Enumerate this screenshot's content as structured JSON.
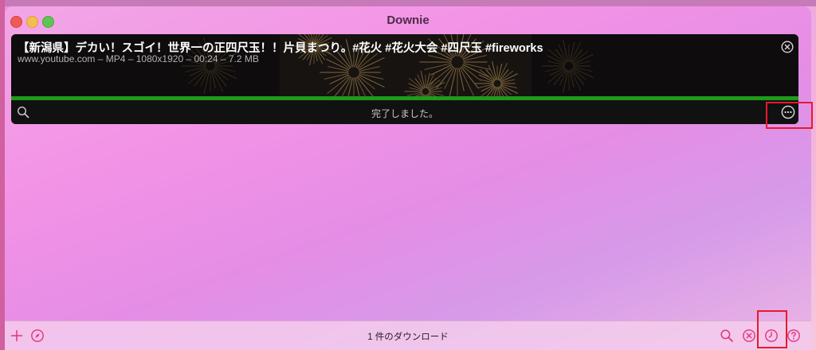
{
  "window": {
    "title": "Downie"
  },
  "download": {
    "title": "【新潟県】デカい！スゴイ！世界一の正四尺玉！！片貝まつり。#花火 #花火大会 #四尺玉 #fireworks",
    "meta": "www.youtube.com – MP4 – 1080x1920 – 00:24 – 7.2 MB",
    "progress": 1.0,
    "status": "完了しました。"
  },
  "footer": {
    "count_label": "1 件のダウンロード"
  },
  "colors": {
    "progress": "#1e9b18",
    "accent": "#e0357e",
    "highlight": "#e8192d"
  },
  "icons": {
    "card": [
      "remove-icon",
      "search-icon",
      "more-icon"
    ],
    "footer": [
      "plus-icon",
      "compass-icon",
      "search-icon",
      "cancel-icon",
      "history-icon",
      "help-icon"
    ]
  }
}
